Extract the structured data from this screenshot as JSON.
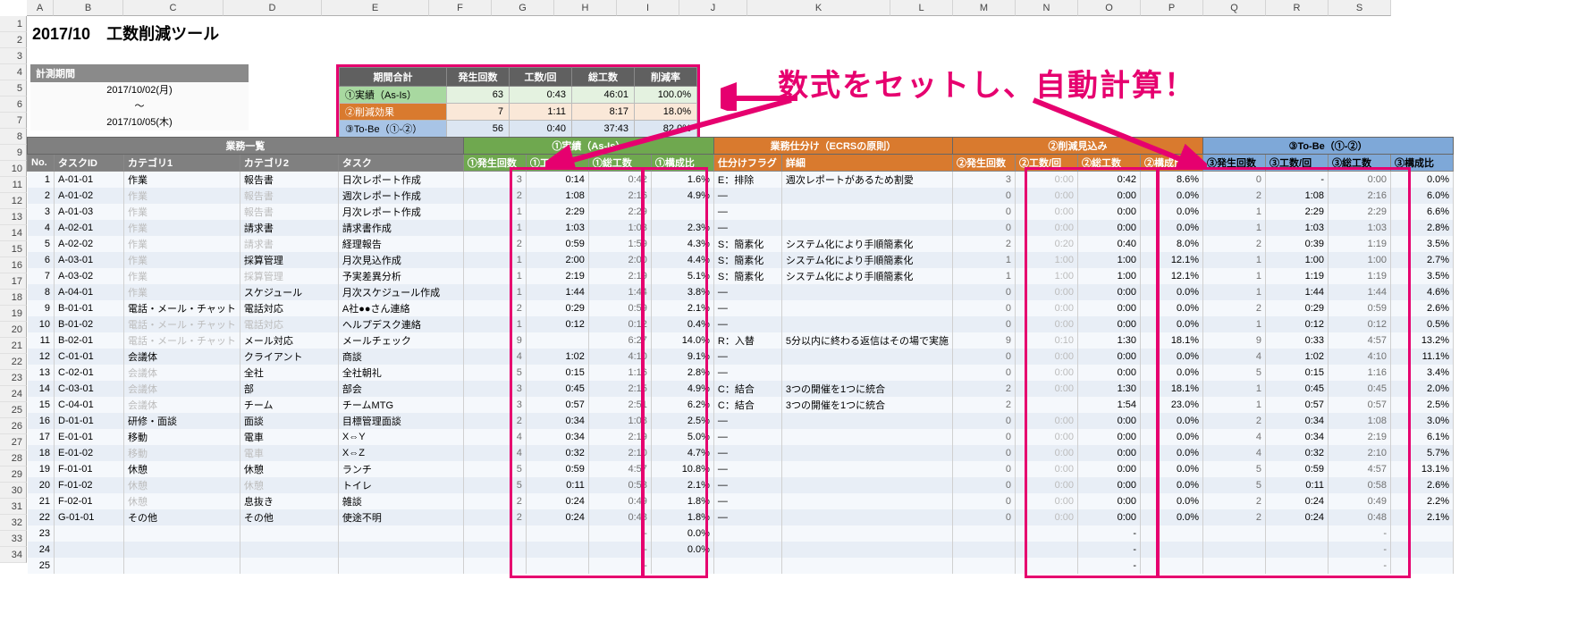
{
  "title": "2017/10　工数削減ツール",
  "period": {
    "header": "計測期間",
    "from": "2017/10/02(月)",
    "sep": "～",
    "to": "2017/10/05(木)"
  },
  "summary": {
    "head": [
      "期間合計",
      "発生回数",
      "工数/回",
      "総工数",
      "削減率"
    ],
    "rows": [
      {
        "lbl": "①実績（As-Is）",
        "v": [
          "63",
          "0:43",
          "46:01",
          "100.0%"
        ]
      },
      {
        "lbl": "②削減効果",
        "v": [
          "7",
          "1:11",
          "8:17",
          "18.0%"
        ]
      },
      {
        "lbl": "③To-Be（①-②）",
        "v": [
          "56",
          "0:40",
          "37:43",
          "82.0%"
        ]
      }
    ]
  },
  "callout": "数式をセットし、自動計算！",
  "letters": [
    "A",
    "B",
    "C",
    "D",
    "E",
    "F",
    "G",
    "H",
    "I",
    "J",
    "K",
    "L",
    "M",
    "N",
    "O",
    "P",
    "Q",
    "R",
    "S"
  ],
  "letterWidths": [
    30,
    78,
    112,
    110,
    120,
    70,
    70,
    70,
    70,
    76,
    160,
    70,
    70,
    70,
    70,
    70,
    70,
    70,
    70
  ],
  "rownums": [
    1,
    2,
    3,
    4,
    5,
    6,
    7,
    8,
    9,
    10,
    11,
    12,
    13,
    14,
    15,
    16,
    17,
    18,
    19,
    20,
    21,
    22,
    23,
    24,
    25,
    26,
    27,
    28,
    29,
    30,
    31,
    32,
    33,
    34
  ],
  "group": {
    "list": "業務一覧",
    "jis": "①実績（As-Is）",
    "ecrs": "業務仕分け（ECRSの原則）",
    "sak": "②削減見込み",
    "tobe": "③To-Be（①-②）"
  },
  "sub": {
    "no": "No.",
    "tid": "タスクID",
    "c1": "カテゴリ1",
    "c2": "カテゴリ2",
    "task": "タスク",
    "jc": "①発生回数",
    "jt": "①工数/回",
    "js": "①総工数",
    "jr": "①構成比",
    "ef": "仕分けフラグ",
    "ed": "詳細",
    "sc": "②発生回数",
    "st": "②工数/回",
    "ss": "②総工数",
    "sr": "②構成比",
    "tc": "③発生回数",
    "tt": "③工数/回",
    "ts": "③総工数",
    "tr": "③構成比"
  },
  "rows": [
    {
      "no": 1,
      "tid": "A-01-01",
      "c1": "作業",
      "c1d": false,
      "c2": "報告書",
      "c2d": false,
      "task": "日次レポート作成",
      "jc": "3",
      "jt": "0:14",
      "js": "0:42",
      "jr": "1.6%",
      "ef": "E：排除",
      "ed": "週次レポートがあるため割愛",
      "sc": "3",
      "st": "0:00",
      "ss": "0:42",
      "sr": "8.6%",
      "tc": "0",
      "tt": "-",
      "ts": "0:00",
      "tr": "0.0%"
    },
    {
      "no": 2,
      "tid": "A-01-02",
      "c1": "作業",
      "c1d": true,
      "c2": "報告書",
      "c2d": true,
      "task": "週次レポート作成",
      "jc": "2",
      "jt": "1:08",
      "js": "2:16",
      "jr": "4.9%",
      "ef": "—",
      "ed": "",
      "sc": "0",
      "st": "0:00",
      "ss": "0:00",
      "sr": "0.0%",
      "tc": "2",
      "tt": "1:08",
      "ts": "2:16",
      "tr": "6.0%"
    },
    {
      "no": 3,
      "tid": "A-01-03",
      "c1": "作業",
      "c1d": true,
      "c2": "報告書",
      "c2d": true,
      "task": "月次レポート作成",
      "jc": "1",
      "jt": "2:29",
      "js": "2:29",
      "jr": "",
      "ef": "—",
      "ed": "",
      "sc": "0",
      "st": "0:00",
      "ss": "0:00",
      "sr": "0.0%",
      "tc": "1",
      "tt": "2:29",
      "ts": "2:29",
      "tr": "6.6%"
    },
    {
      "no": 4,
      "tid": "A-02-01",
      "c1": "作業",
      "c1d": true,
      "c2": "請求書",
      "c2d": false,
      "task": "請求書作成",
      "jc": "1",
      "jt": "1:03",
      "js": "1:03",
      "jr": "2.3%",
      "ef": "—",
      "ed": "",
      "sc": "0",
      "st": "0:00",
      "ss": "0:00",
      "sr": "0.0%",
      "tc": "1",
      "tt": "1:03",
      "ts": "1:03",
      "tr": "2.8%"
    },
    {
      "no": 5,
      "tid": "A-02-02",
      "c1": "作業",
      "c1d": true,
      "c2": "請求書",
      "c2d": true,
      "task": "経理報告",
      "jc": "2",
      "jt": "0:59",
      "js": "1:59",
      "jr": "4.3%",
      "ef": "S：簡素化",
      "ed": "システム化により手順簡素化",
      "sc": "2",
      "st": "0:20",
      "ss": "0:40",
      "sr": "8.0%",
      "tc": "2",
      "tt": "0:39",
      "ts": "1:19",
      "tr": "3.5%"
    },
    {
      "no": 6,
      "tid": "A-03-01",
      "c1": "作業",
      "c1d": true,
      "c2": "採算管理",
      "c2d": false,
      "task": "月次見込作成",
      "jc": "1",
      "jt": "2:00",
      "js": "2:00",
      "jr": "4.4%",
      "ef": "S：簡素化",
      "ed": "システム化により手順簡素化",
      "sc": "1",
      "st": "1:00",
      "ss": "1:00",
      "sr": "12.1%",
      "tc": "1",
      "tt": "1:00",
      "ts": "1:00",
      "tr": "2.7%"
    },
    {
      "no": 7,
      "tid": "A-03-02",
      "c1": "作業",
      "c1d": true,
      "c2": "採算管理",
      "c2d": true,
      "task": "予実差異分析",
      "jc": "1",
      "jt": "2:19",
      "js": "2:19",
      "jr": "5.1%",
      "ef": "S：簡素化",
      "ed": "システム化により手順簡素化",
      "sc": "1",
      "st": "1:00",
      "ss": "1:00",
      "sr": "12.1%",
      "tc": "1",
      "tt": "1:19",
      "ts": "1:19",
      "tr": "3.5%"
    },
    {
      "no": 8,
      "tid": "A-04-01",
      "c1": "作業",
      "c1d": true,
      "c2": "スケジュール",
      "c2d": false,
      "task": "月次スケジュール作成",
      "jc": "1",
      "jt": "1:44",
      "js": "1:44",
      "jr": "3.8%",
      "ef": "—",
      "ed": "",
      "sc": "0",
      "st": "0:00",
      "ss": "0:00",
      "sr": "0.0%",
      "tc": "1",
      "tt": "1:44",
      "ts": "1:44",
      "tr": "4.6%"
    },
    {
      "no": 9,
      "tid": "B-01-01",
      "c1": "電話・メール・チャット",
      "c1d": false,
      "c2": "電話対応",
      "c2d": false,
      "task": "A社●●さん連絡",
      "jc": "2",
      "jt": "0:29",
      "js": "0:59",
      "jr": "2.1%",
      "ef": "—",
      "ed": "",
      "sc": "0",
      "st": "0:00",
      "ss": "0:00",
      "sr": "0.0%",
      "tc": "2",
      "tt": "0:29",
      "ts": "0:59",
      "tr": "2.6%"
    },
    {
      "no": 10,
      "tid": "B-01-02",
      "c1": "電話・メール・チャット",
      "c1d": true,
      "c2": "電話対応",
      "c2d": true,
      "task": "ヘルプデスク連絡",
      "jc": "1",
      "jt": "0:12",
      "js": "0:12",
      "jr": "0.4%",
      "ef": "—",
      "ed": "",
      "sc": "0",
      "st": "0:00",
      "ss": "0:00",
      "sr": "0.0%",
      "tc": "1",
      "tt": "0:12",
      "ts": "0:12",
      "tr": "0.5%"
    },
    {
      "no": 11,
      "tid": "B-02-01",
      "c1": "電話・メール・チャット",
      "c1d": true,
      "c2": "メール対応",
      "c2d": false,
      "task": "メールチェック",
      "jc": "9",
      "jt": "",
      "js": "6:27",
      "jr": "14.0%",
      "ef": "R：入替",
      "ed": "5分以内に終わる返信はその場で実施",
      "sc": "9",
      "st": "0:10",
      "ss": "1:30",
      "sr": "18.1%",
      "tc": "9",
      "tt": "0:33",
      "ts": "4:57",
      "tr": "13.2%"
    },
    {
      "no": 12,
      "tid": "C-01-01",
      "c1": "会議体",
      "c1d": false,
      "c2": "クライアント",
      "c2d": false,
      "task": "商談",
      "jc": "4",
      "jt": "1:02",
      "js": "4:10",
      "jr": "9.1%",
      "ef": "—",
      "ed": "",
      "sc": "0",
      "st": "0:00",
      "ss": "0:00",
      "sr": "0.0%",
      "tc": "4",
      "tt": "1:02",
      "ts": "4:10",
      "tr": "11.1%"
    },
    {
      "no": 13,
      "tid": "C-02-01",
      "c1": "会議体",
      "c1d": true,
      "c2": "全社",
      "c2d": false,
      "task": "全社朝礼",
      "jc": "5",
      "jt": "0:15",
      "js": "1:16",
      "jr": "2.8%",
      "ef": "—",
      "ed": "",
      "sc": "0",
      "st": "0:00",
      "ss": "0:00",
      "sr": "0.0%",
      "tc": "5",
      "tt": "0:15",
      "ts": "1:16",
      "tr": "3.4%"
    },
    {
      "no": 14,
      "tid": "C-03-01",
      "c1": "会議体",
      "c1d": true,
      "c2": "部",
      "c2d": false,
      "task": "部会",
      "jc": "3",
      "jt": "0:45",
      "js": "2:15",
      "jr": "4.9%",
      "ef": "C：結合",
      "ed": "3つの開催を1つに統合",
      "sc": "2",
      "st": "0:00",
      "ss": "1:30",
      "sr": "18.1%",
      "tc": "1",
      "tt": "0:45",
      "ts": "0:45",
      "tr": "2.0%"
    },
    {
      "no": 15,
      "tid": "C-04-01",
      "c1": "会議体",
      "c1d": true,
      "c2": "チーム",
      "c2d": false,
      "task": "チームMTG",
      "jc": "3",
      "jt": "0:57",
      "js": "2:51",
      "jr": "6.2%",
      "ef": "C：結合",
      "ed": "3つの開催を1つに統合",
      "sc": "2",
      "st": "",
      "ss": "1:54",
      "sr": "23.0%",
      "tc": "1",
      "tt": "0:57",
      "ts": "0:57",
      "tr": "2.5%"
    },
    {
      "no": 16,
      "tid": "D-01-01",
      "c1": "研修・面談",
      "c1d": false,
      "c2": "面談",
      "c2d": false,
      "task": "目標管理面談",
      "jc": "2",
      "jt": "0:34",
      "js": "1:08",
      "jr": "2.5%",
      "ef": "—",
      "ed": "",
      "sc": "0",
      "st": "0:00",
      "ss": "0:00",
      "sr": "0.0%",
      "tc": "2",
      "tt": "0:34",
      "ts": "1:08",
      "tr": "3.0%"
    },
    {
      "no": 17,
      "tid": "E-01-01",
      "c1": "移動",
      "c1d": false,
      "c2": "電車",
      "c2d": false,
      "task": "X⇔Y",
      "jc": "4",
      "jt": "0:34",
      "js": "2:19",
      "jr": "5.0%",
      "ef": "—",
      "ed": "",
      "sc": "0",
      "st": "0:00",
      "ss": "0:00",
      "sr": "0.0%",
      "tc": "4",
      "tt": "0:34",
      "ts": "2:19",
      "tr": "6.1%"
    },
    {
      "no": 18,
      "tid": "E-01-02",
      "c1": "移動",
      "c1d": true,
      "c2": "電車",
      "c2d": true,
      "task": "X⇔Z",
      "jc": "4",
      "jt": "0:32",
      "js": "2:10",
      "jr": "4.7%",
      "ef": "—",
      "ed": "",
      "sc": "0",
      "st": "0:00",
      "ss": "0:00",
      "sr": "0.0%",
      "tc": "4",
      "tt": "0:32",
      "ts": "2:10",
      "tr": "5.7%"
    },
    {
      "no": 19,
      "tid": "F-01-01",
      "c1": "休憩",
      "c1d": false,
      "c2": "休憩",
      "c2d": false,
      "task": "ランチ",
      "jc": "5",
      "jt": "0:59",
      "js": "4:57",
      "jr": "10.8%",
      "ef": "—",
      "ed": "",
      "sc": "0",
      "st": "0:00",
      "ss": "0:00",
      "sr": "0.0%",
      "tc": "5",
      "tt": "0:59",
      "ts": "4:57",
      "tr": "13.1%"
    },
    {
      "no": 20,
      "tid": "F-01-02",
      "c1": "休憩",
      "c1d": true,
      "c2": "休憩",
      "c2d": true,
      "task": "トイレ",
      "jc": "5",
      "jt": "0:11",
      "js": "0:58",
      "jr": "2.1%",
      "ef": "—",
      "ed": "",
      "sc": "0",
      "st": "0:00",
      "ss": "0:00",
      "sr": "0.0%",
      "tc": "5",
      "tt": "0:11",
      "ts": "0:58",
      "tr": "2.6%"
    },
    {
      "no": 21,
      "tid": "F-02-01",
      "c1": "休憩",
      "c1d": true,
      "c2": "息抜き",
      "c2d": false,
      "task": "雑談",
      "jc": "2",
      "jt": "0:24",
      "js": "0:49",
      "jr": "1.8%",
      "ef": "—",
      "ed": "",
      "sc": "0",
      "st": "0:00",
      "ss": "0:00",
      "sr": "0.0%",
      "tc": "2",
      "tt": "0:24",
      "ts": "0:49",
      "tr": "2.2%"
    },
    {
      "no": 22,
      "tid": "G-01-01",
      "c1": "その他",
      "c1d": false,
      "c2": "その他",
      "c2d": false,
      "task": "使途不明",
      "jc": "2",
      "jt": "0:24",
      "js": "0:48",
      "jr": "1.8%",
      "ef": "—",
      "ed": "",
      "sc": "0",
      "st": "0:00",
      "ss": "0:00",
      "sr": "0.0%",
      "tc": "2",
      "tt": "0:24",
      "ts": "0:48",
      "tr": "2.1%"
    },
    {
      "no": 23,
      "tid": "",
      "c1": "",
      "c1d": true,
      "c2": "",
      "c2d": true,
      "task": "",
      "jc": "",
      "jt": "",
      "js": "-",
      "jr": "0.0%",
      "ef": "",
      "ed": "",
      "sc": "",
      "st": "",
      "ss": "-",
      "sr": "",
      "tc": "",
      "tt": "",
      "ts": "-",
      "tr": ""
    },
    {
      "no": 24,
      "tid": "",
      "c1": "",
      "c1d": true,
      "c2": "",
      "c2d": true,
      "task": "",
      "jc": "",
      "jt": "",
      "js": "-",
      "jr": "0.0%",
      "ef": "",
      "ed": "",
      "sc": "",
      "st": "",
      "ss": "-",
      "sr": "",
      "tc": "",
      "tt": "",
      "ts": "-",
      "tr": ""
    },
    {
      "no": 25,
      "tid": "",
      "c1": "",
      "c1d": true,
      "c2": "",
      "c2d": true,
      "task": "",
      "jc": "",
      "jt": "",
      "js": "-",
      "jr": "",
      "ef": "",
      "ed": "",
      "sc": "",
      "st": "",
      "ss": "-",
      "sr": "",
      "tc": "",
      "tt": "",
      "ts": "-",
      "tr": ""
    }
  ]
}
